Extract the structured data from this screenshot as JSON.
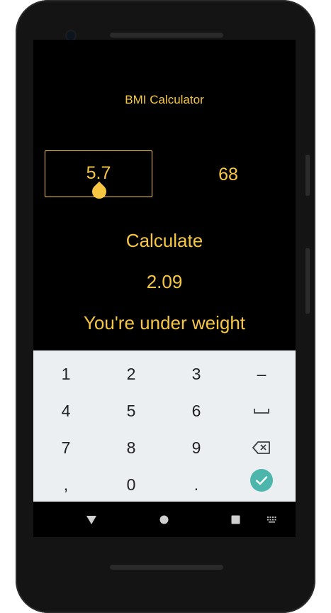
{
  "app": {
    "title": "BMI Calculator",
    "height_value": "5.7",
    "weight_value": "68",
    "calculate_label": "Calculate",
    "bmi_result": "2.09",
    "result_message": "You're under weight"
  },
  "keyboard": {
    "rows": [
      [
        "1",
        "2",
        "3",
        "–"
      ],
      [
        "4",
        "5",
        "6",
        "space"
      ],
      [
        "7",
        "8",
        "9",
        "backspace"
      ],
      [
        ",",
        "0",
        ".",
        "done"
      ]
    ],
    "key_labels": {
      "k1": "1",
      "k2": "2",
      "k3": "3",
      "dash": "–",
      "k4": "4",
      "k5": "5",
      "k6": "6",
      "k7": "7",
      "k8": "8",
      "k9": "9",
      "comma": ",",
      "k0": "0",
      "period": "."
    }
  },
  "colors": {
    "accent": "#f7c744",
    "screen_background": "#000000",
    "keyboard_background": "#eceff1",
    "done_key": "#4db6ac"
  },
  "icons": {
    "space_key": "space-bar-icon",
    "backspace_key": "backspace-icon",
    "done_key": "checkmark-icon",
    "nav_back": "back-triangle-icon",
    "nav_home": "home-circle-icon",
    "nav_recents": "recents-square-icon",
    "nav_keyboard": "keyboard-switch-icon"
  }
}
